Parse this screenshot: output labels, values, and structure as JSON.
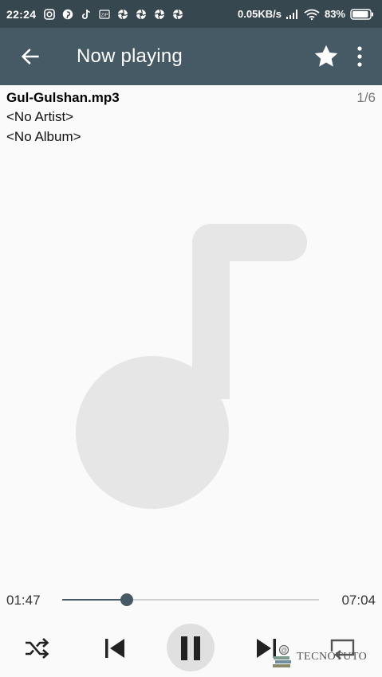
{
  "status_bar": {
    "time": "22:24",
    "net_speed": "0.05KB/s",
    "battery": "83%",
    "icons": [
      "instagram-icon",
      "pinterest-icon",
      "tiktok-icon",
      "zip-icon",
      "aperture-icon",
      "aperture-icon",
      "aperture-icon",
      "aperture-icon"
    ]
  },
  "toolbar": {
    "title": "Now playing",
    "back_icon": "arrow-left-icon",
    "favorite_icon": "star-icon",
    "menu_icon": "more-vert-icon"
  },
  "track": {
    "filename": "Gul-Gulshan.mp3",
    "position": "1/6",
    "artist": "<No Artist>",
    "album": "<No Album>"
  },
  "playback": {
    "elapsed": "01:47",
    "duration": "07:04",
    "progress_fraction": 0.252
  },
  "controls": [
    "shuffle-icon",
    "skip-previous-icon",
    "pause-icon",
    "skip-next-icon",
    "repeat-icon"
  ],
  "watermark": {
    "text": "TECNOTUTO"
  },
  "colors": {
    "status_bar": "#37474f",
    "toolbar": "#455a64",
    "accent": "#455a64",
    "background": "#fafafa",
    "art_placeholder": "#e6e6e6"
  }
}
